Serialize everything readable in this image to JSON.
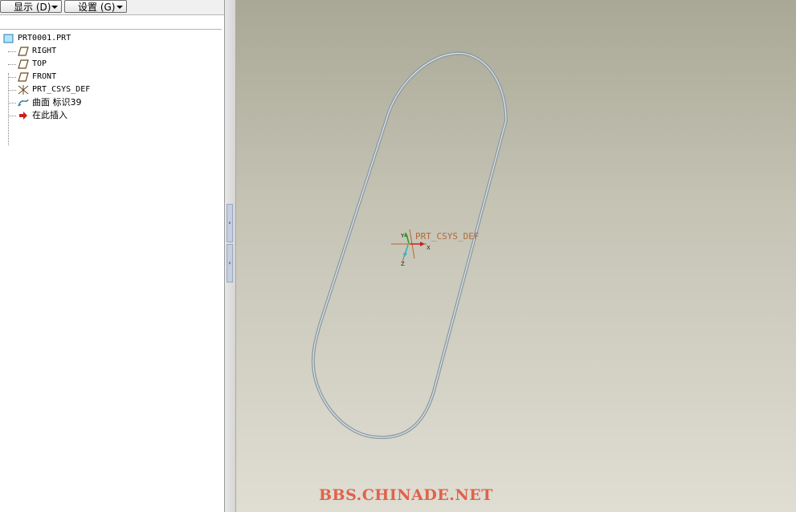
{
  "toolbar": {
    "display_label": "显示 (D)",
    "settings_label": "设置 (G)"
  },
  "tree": {
    "root": "PRT0001.PRT",
    "items": [
      {
        "label": "RIGHT",
        "icon": "datum-plane-icon"
      },
      {
        "label": "TOP",
        "icon": "datum-plane-icon"
      },
      {
        "label": "FRONT",
        "icon": "datum-plane-icon"
      },
      {
        "label": "PRT_CSYS_DEF",
        "icon": "coordinate-system-icon"
      },
      {
        "label": "曲面 标识39",
        "icon": "surface-icon"
      },
      {
        "label": "在此插入",
        "icon": "insert-here-arrow-icon"
      }
    ]
  },
  "viewport": {
    "csys_label": "PRT_CSYS_DEF",
    "axis_x": "X",
    "axis_y": "Y",
    "axis_z": "Z",
    "watermark": "BBS.CHINADE.NET"
  },
  "colors": {
    "model_edge": "#8e9ba3",
    "csys_text": "#b06a3a",
    "watermark": "#e0624b",
    "insert_arrow": "#cc1f1f"
  }
}
